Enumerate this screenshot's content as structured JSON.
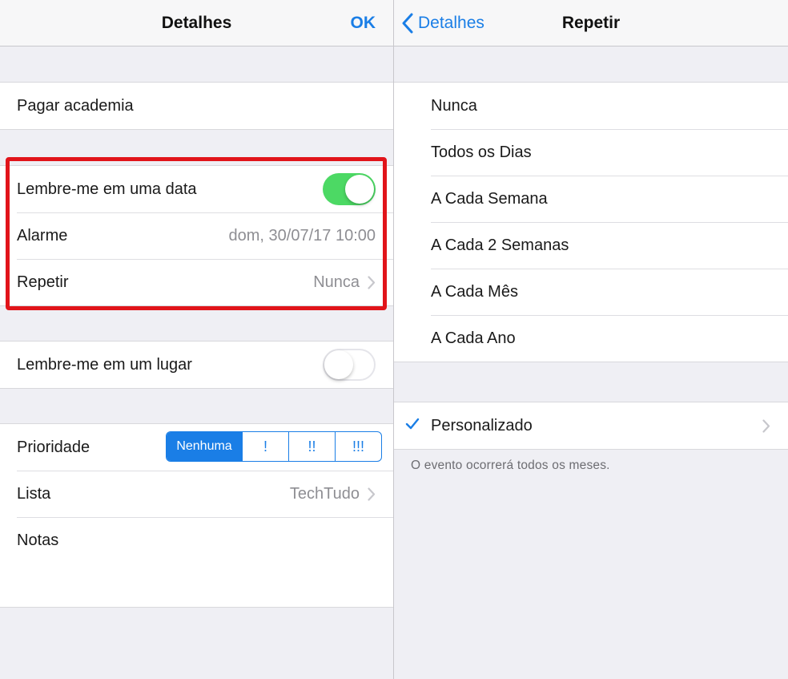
{
  "left": {
    "title": "Detalhes",
    "ok_label": "OK",
    "title_field": "Pagar academia",
    "remind_date": {
      "label": "Lembre-me em uma data",
      "enabled": true
    },
    "alarm": {
      "label": "Alarme",
      "value": "dom, 30/07/17 10:00"
    },
    "repeat": {
      "label": "Repetir",
      "value": "Nunca"
    },
    "remind_place": {
      "label": "Lembre-me em um lugar",
      "enabled": false
    },
    "priority": {
      "label": "Prioridade",
      "options": [
        "Nenhuma",
        "!",
        "!!",
        "!!!"
      ],
      "selected": "Nenhuma"
    },
    "list": {
      "label": "Lista",
      "value": "TechTudo"
    },
    "notes_label": "Notas"
  },
  "right": {
    "back_label": "Detalhes",
    "title": "Repetir",
    "options": [
      "Nunca",
      "Todos os Dias",
      "A Cada Semana",
      "A Cada 2 Semanas",
      "A Cada Mês",
      "A Cada Ano"
    ],
    "custom_label": "Personalizado",
    "custom_selected": true,
    "footer": "O evento ocorrerá todos os meses."
  },
  "colors": {
    "accent": "#1a7ee6",
    "toggle_on": "#4cd964",
    "highlight": "#e1141a"
  },
  "icons": [
    "chevron-right-icon",
    "chevron-left-icon",
    "checkmark-icon"
  ]
}
